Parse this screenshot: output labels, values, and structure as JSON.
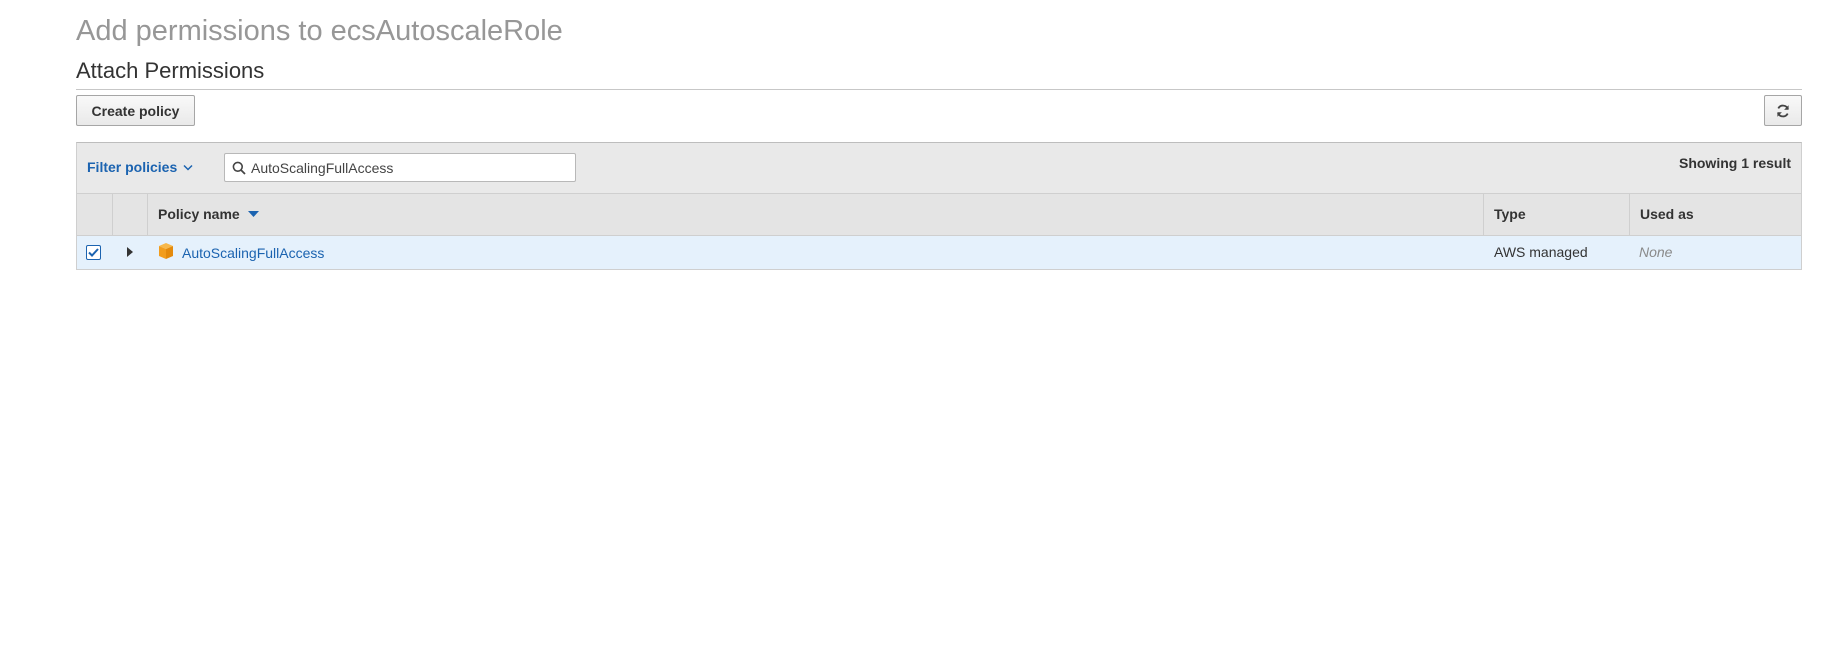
{
  "page": {
    "title": "Add permissions to ecsAutoscaleRole",
    "section_title": "Attach Permissions"
  },
  "toolbar": {
    "create_policy_label": "Create policy",
    "refresh_icon": "refresh-icon"
  },
  "filter": {
    "filter_label": "Filter policies",
    "search_value": "AutoScalingFullAccess",
    "result_count": "Showing 1 result"
  },
  "table": {
    "columns": [
      "Policy name",
      "Type",
      "Used as"
    ],
    "sorted_column": "Policy name",
    "rows": [
      {
        "selected": true,
        "name": "AutoScalingFullAccess",
        "type": "AWS managed",
        "used_as": "None",
        "icon": "package-icon"
      }
    ]
  },
  "colors": {
    "link": "#1b63b0",
    "selected_row": "#e5f1fc",
    "package_icon": "#f29d1d"
  }
}
